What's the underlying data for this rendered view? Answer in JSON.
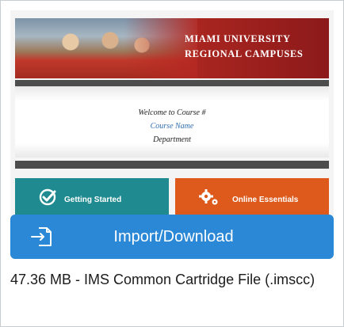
{
  "preview": {
    "banner_line1": "MIAMI UNIVERSITY",
    "banner_line2": "REGIONAL CAMPUSES",
    "welcome": "Welcome to Course #",
    "course_name": "Course Name",
    "department": "Department",
    "tile_left": {
      "label": "Getting Started",
      "color": "#1f8a8f",
      "icon": "check-circle-icon"
    },
    "tile_right": {
      "label": "Online Essentials",
      "color": "#dd5a1c",
      "icon": "gears-icon"
    }
  },
  "import_button": {
    "label": "Import/Download",
    "color": "#2a88d6",
    "icon": "import-icon"
  },
  "file": {
    "info": "47.36 MB - IMS Common Cartridge File (.imscc)"
  }
}
